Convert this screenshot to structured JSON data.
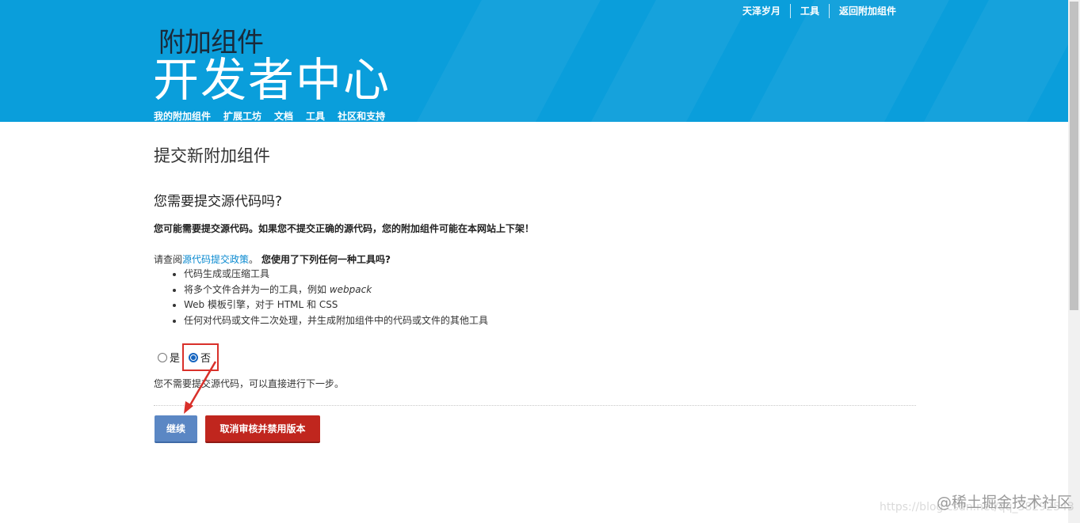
{
  "header": {
    "top_links": [
      "天泽岁月",
      "工具",
      "返回附加组件"
    ],
    "title_small": "附加组件",
    "title_large": "开发者中心",
    "nav": [
      "我的附加组件",
      "扩展工坊",
      "文档",
      "工具",
      "社区和支持"
    ],
    "bg_color": "#0a9edb"
  },
  "main": {
    "page_title": "提交新附加组件",
    "section_heading": "您需要提交源代码吗?",
    "warning": "您可能需要提交源代码。如果您不提交正确的源代码，您的附加组件可能在本网站上下架！",
    "policy_prefix": "请查阅",
    "policy_link": "源代码提交政策",
    "policy_suffix": "。",
    "policy_question": "您使用了下列任何一种工具吗?",
    "tools": [
      "代码生成或压缩工具",
      "将多个文件合并为一的工具，例如 ",
      "Web 模板引擎，对于 HTML 和 CSS",
      "任何对代码或文件二次处理，并生成附加组件中的代码或文件的其他工具"
    ],
    "tool_example": "webpack",
    "radio_yes": "是",
    "radio_no": "否",
    "selected": "否",
    "no_source_msg": "您不需要提交源代码，可以直接进行下一步。",
    "continue_label": "继续",
    "cancel_label": "取消审核并禁用版本",
    "continue_color": "#5b87c4",
    "cancel_color": "#c0261e"
  },
  "annotation": {
    "highlight_color": "#d9302a"
  },
  "watermark": {
    "url": "https://blog.csdn.net/qq_38292543",
    "brand": "@稀土掘金技术社区"
  }
}
